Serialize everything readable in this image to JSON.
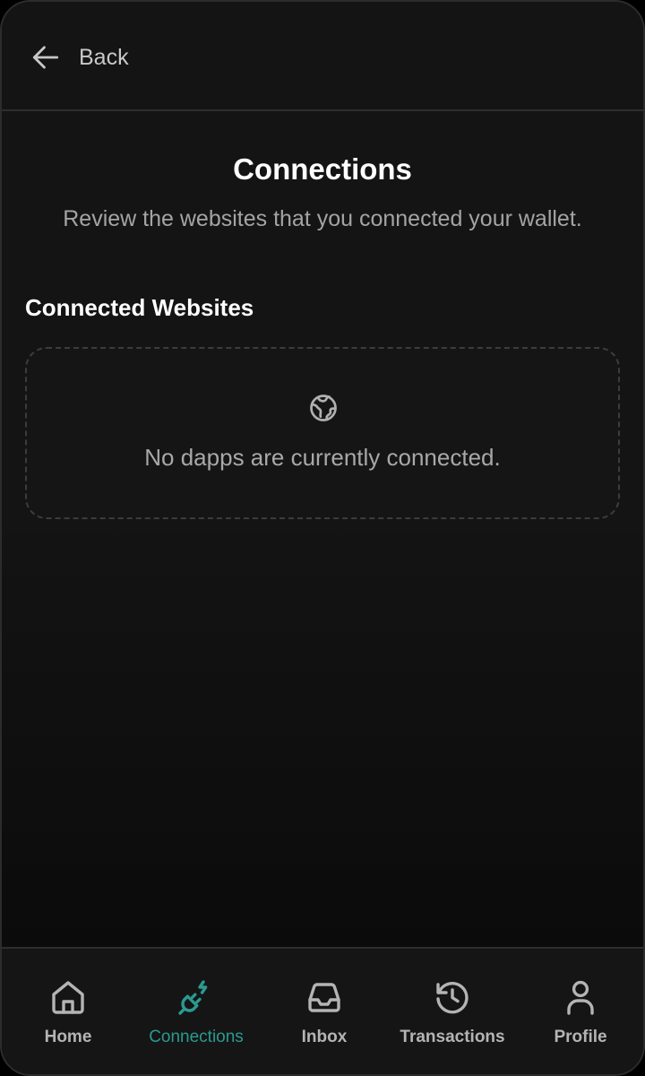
{
  "header": {
    "back_label": "Back",
    "back_icon": "arrow-left-icon"
  },
  "page": {
    "title": "Connections",
    "subtitle": "Review the websites that you connected your wallet."
  },
  "connected_websites": {
    "heading": "Connected Websites",
    "empty_icon": "globe-icon",
    "empty_message": "No dapps are currently connected.",
    "items": []
  },
  "nav": {
    "active": "connections",
    "active_color": "#2a9a90",
    "items": [
      {
        "id": "home",
        "label": "Home",
        "icon": "home-icon"
      },
      {
        "id": "connections",
        "label": "Connections",
        "icon": "plug-icon"
      },
      {
        "id": "inbox",
        "label": "Inbox",
        "icon": "inbox-icon"
      },
      {
        "id": "transactions",
        "label": "Transactions",
        "icon": "history-icon"
      },
      {
        "id": "profile",
        "label": "Profile",
        "icon": "user-icon"
      }
    ]
  },
  "colors": {
    "background": "#141414",
    "text_primary": "#ffffff",
    "text_secondary": "#a4a4a4",
    "accent": "#2a9a90"
  }
}
